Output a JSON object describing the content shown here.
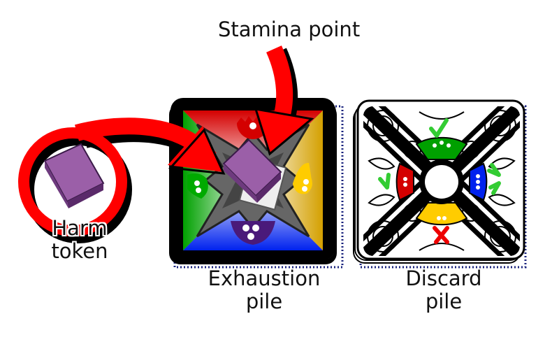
{
  "labels": {
    "stamina_point": "Stamina point",
    "harm_token_line1": "Harm",
    "harm_token_line2": "token",
    "exhaustion_pile_line1": "Exhaustion",
    "exhaustion_pile_line2": "pile",
    "discard_pile_line1": "Discard",
    "discard_pile_line2": "pile"
  },
  "colors": {
    "arrow": "#ff0000",
    "token_fill": "#9b5fa8",
    "quadrant_red": "#d40000",
    "quadrant_yellow": "#d4a000",
    "quadrant_blue": "#0022ee",
    "quadrant_green": "#00a000",
    "check_green": "#33cc33",
    "cross_red": "#ee0000",
    "dotted_border": "#1a237e"
  },
  "icons": [
    "crown-icon",
    "drop-icon",
    "shield-icon",
    "checkmark-icon",
    "cross-icon"
  ]
}
